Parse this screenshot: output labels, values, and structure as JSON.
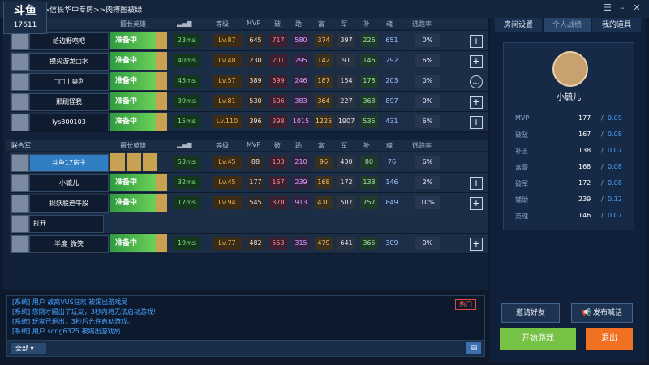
{
  "title": {
    "breadcrumb": "电信华中>>信长华中专房>>肉搏图被绿",
    "logo_text": "斗鱼",
    "logo_sub": "17611"
  },
  "headers": {
    "col_hero": "擅长英雄",
    "col_level": "等级",
    "col_mvp": "MVP",
    "col_po": "破",
    "col_zhu": "助",
    "col_fu": "富",
    "col_jun": "军",
    "col_bu": "补",
    "col_hun": "魂",
    "col_escape": "逃跑率"
  },
  "team2_label": "联合军",
  "team1": [
    {
      "name": "给边野咆吧",
      "status": "准备中",
      "ping": "23ms",
      "level": "Lv.87",
      "stats": [
        645,
        717,
        580,
        374,
        397,
        226,
        651
      ],
      "escape": "0%",
      "action": "+"
    },
    {
      "name": "摸尖游龙□水",
      "status": "准备中",
      "ping": "40ms",
      "level": "Lv.48",
      "stats": [
        230,
        201,
        295,
        142,
        91,
        146,
        292
      ],
      "escape": "6%",
      "action": "+"
    },
    {
      "name": "□□丨爽利",
      "status": "准备中",
      "ping": "45ms",
      "level": "Lv.57",
      "stats": [
        389,
        399,
        246,
        187,
        154,
        178,
        203
      ],
      "escape": "0%",
      "action": "…"
    },
    {
      "name": "那刷怪我",
      "status": "准备中",
      "ping": "39ms",
      "level": "Lv.81",
      "stats": [
        530,
        506,
        383,
        364,
        227,
        368,
        897
      ],
      "escape": "0%",
      "action": "+"
    },
    {
      "name": "lys800103",
      "status": "准备中",
      "ping": "15ms",
      "level": "Lv.110",
      "stats": [
        396,
        298,
        1015,
        1225,
        1907,
        535,
        431
      ],
      "escape": "6%",
      "action": "+"
    }
  ],
  "team2": [
    {
      "name": "斗鱼17房主",
      "status": "",
      "ping": "53ms",
      "level": "Lv.45",
      "stats": [
        88,
        103,
        210,
        96,
        430,
        80,
        76
      ],
      "escape": "6%",
      "action": ""
    },
    {
      "name": "小毓儿",
      "status": "准备中",
      "ping": "32ms",
      "level": "Lv.45",
      "stats": [
        177,
        167,
        239,
        168,
        172,
        138,
        146
      ],
      "escape": "2%",
      "action": "+"
    },
    {
      "name": "捉妖股迪牛股",
      "status": "准备中",
      "ping": "17ms",
      "level": "Lv.94",
      "stats": [
        545,
        370,
        913,
        410,
        507,
        757,
        849
      ],
      "escape": "10%",
      "action": "+"
    },
    {
      "name": "打开",
      "status": "",
      "ping": "",
      "level": "",
      "stats": [],
      "escape": "",
      "action": ""
    },
    {
      "name": "半度_微笑",
      "status": "准备中",
      "ping": "19ms",
      "level": "Lv.77",
      "stats": [
        482,
        553,
        315,
        479,
        641,
        365,
        309
      ],
      "escape": "0%",
      "action": "+"
    }
  ],
  "chat": {
    "hot_badge": "热门",
    "messages": [
      "[系统] 用户 故高VUS狂欢 被踢出游戏局",
      "[系统] 您刚才踢出了玩友，3秒内将无法启动游戏!",
      "[系统] 玩家已退出，3秒后允许启动游戏。",
      "[系统] 用户 song6325 被踢出游戏局"
    ],
    "channel": "全部"
  },
  "right": {
    "tabs": [
      "房间设置",
      "个人战绩",
      "我的道具"
    ],
    "profile_name": "小毓儿",
    "stats": [
      {
        "k": "MVP",
        "v": "177",
        "r": "0.09"
      },
      {
        "k": "破敌",
        "v": "167",
        "r": "0.08"
      },
      {
        "k": "补王",
        "v": "138",
        "r": "0.07"
      },
      {
        "k": "富豪",
        "v": "168",
        "r": "0.08"
      },
      {
        "k": "破军",
        "v": "172",
        "r": "0.08"
      },
      {
        "k": "辅助",
        "v": "239",
        "r": "0.12"
      },
      {
        "k": "英魂",
        "v": "146",
        "r": "0.07"
      }
    ],
    "invite": "邀请好友",
    "broadcast": "发布喊话",
    "start": "开始游戏",
    "exit": "退出"
  }
}
